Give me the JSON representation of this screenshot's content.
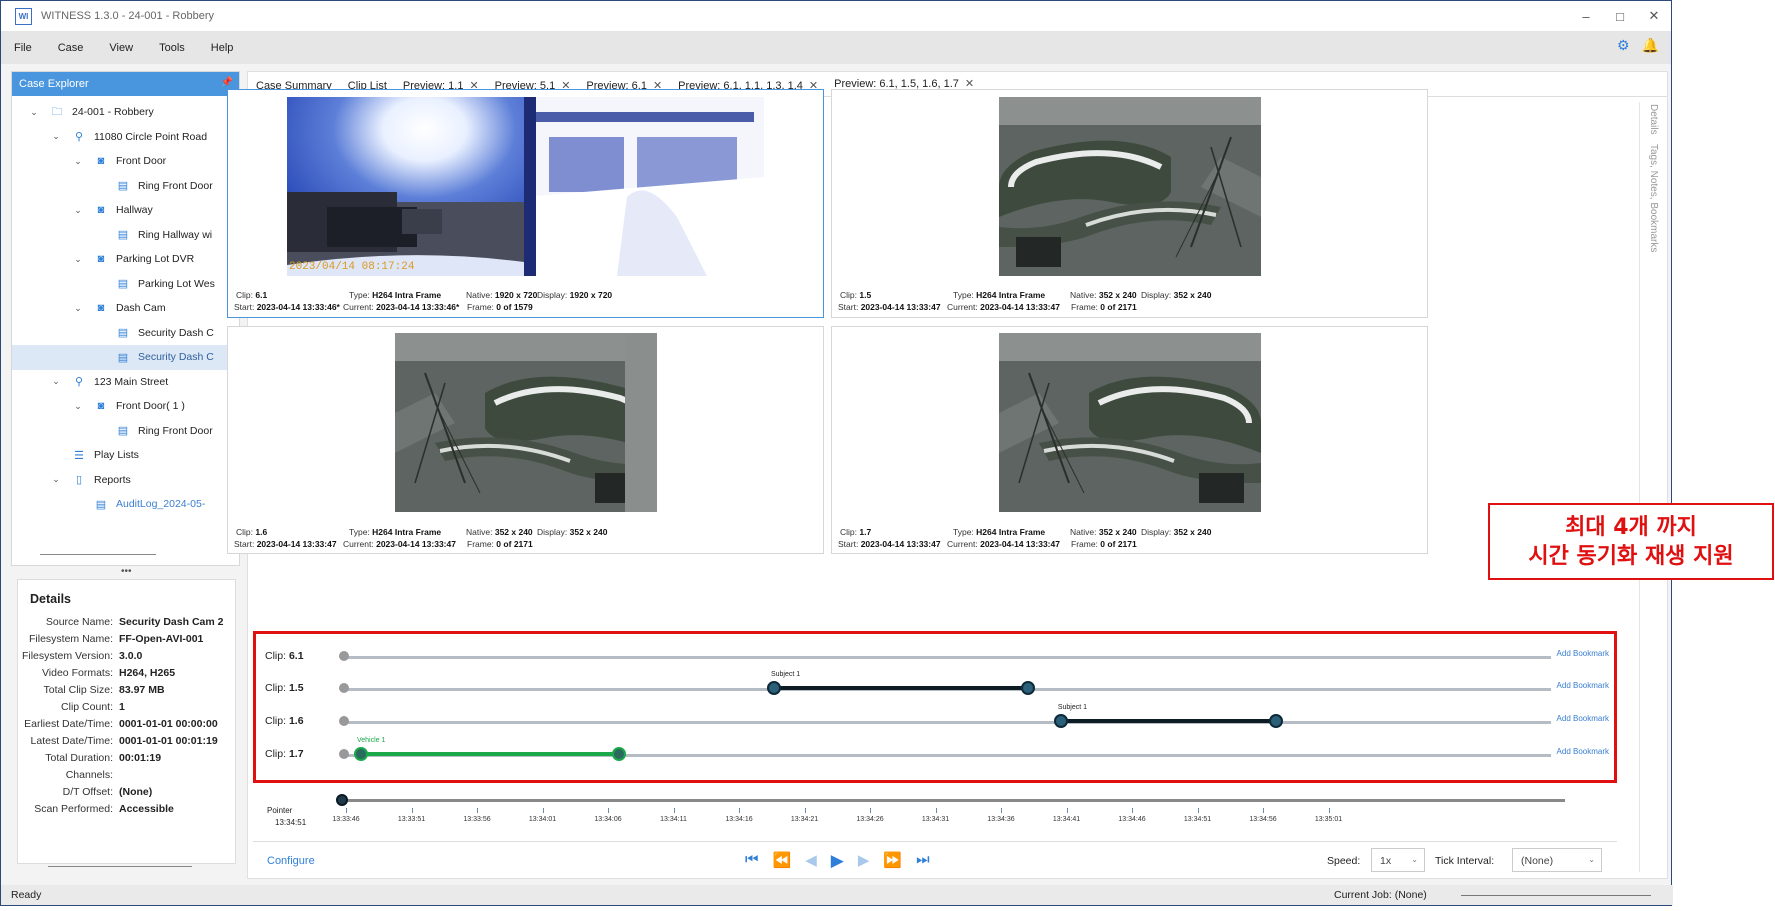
{
  "window": {
    "title": "WITNESS 1.3.0 - 24-001 - Robbery",
    "logo": "WI",
    "minimize": "–",
    "maximize": "□",
    "close": "✕"
  },
  "menu": [
    "File",
    "Case",
    "View",
    "Tools",
    "Help"
  ],
  "explorer": {
    "title": "Case Explorer",
    "tree": [
      {
        "label": "24-001 - Robbery",
        "depth": 0,
        "caret": "⌄",
        "icon": "folder-icon",
        "glyph": "🗀"
      },
      {
        "label": "11080 Circle Point Road",
        "depth": 1,
        "caret": "⌄",
        "icon": "location-pin-icon",
        "glyph": "⚲"
      },
      {
        "label": "Front Door",
        "depth": 2,
        "caret": "⌄",
        "icon": "camera-icon",
        "glyph": "◙"
      },
      {
        "label": "Ring Front Door",
        "depth": 3,
        "caret": "",
        "icon": "video-file-icon",
        "glyph": "▤"
      },
      {
        "label": "Hallway",
        "depth": 2,
        "caret": "⌄",
        "icon": "camera-icon",
        "glyph": "◙"
      },
      {
        "label": "Ring Hallway wi",
        "depth": 3,
        "caret": "",
        "icon": "video-file-icon",
        "glyph": "▤"
      },
      {
        "label": "Parking Lot DVR",
        "depth": 2,
        "caret": "⌄",
        "icon": "camera-icon",
        "glyph": "◙"
      },
      {
        "label": "Parking Lot Wes",
        "depth": 3,
        "caret": "",
        "icon": "video-file-icon",
        "glyph": "▤"
      },
      {
        "label": "Dash Cam",
        "depth": 2,
        "caret": "⌄",
        "icon": "camera-icon",
        "glyph": "◙"
      },
      {
        "label": "Security Dash C",
        "depth": 3,
        "caret": "",
        "icon": "video-file-icon",
        "glyph": "▤"
      },
      {
        "label": "Security Dash C",
        "depth": 3,
        "caret": "",
        "icon": "video-file-icon",
        "glyph": "▤",
        "selected": true
      },
      {
        "label": "123 Main Street",
        "depth": 1,
        "caret": "⌄",
        "icon": "location-pin-icon",
        "glyph": "⚲"
      },
      {
        "label": "Front Door( 1 )",
        "depth": 2,
        "caret": "⌄",
        "icon": "camera-icon",
        "glyph": "◙"
      },
      {
        "label": "Ring Front Door",
        "depth": 3,
        "caret": "",
        "icon": "video-file-icon",
        "glyph": "▤"
      },
      {
        "label": "Play Lists",
        "depth": 1,
        "caret": "",
        "icon": "list-icon",
        "glyph": "☰"
      },
      {
        "label": "Reports",
        "depth": 1,
        "caret": "⌄",
        "icon": "document-icon",
        "glyph": "▯"
      },
      {
        "label": "AuditLog_2024-05-",
        "depth": 2,
        "caret": "",
        "icon": "pdf-icon",
        "glyph": "▤",
        "link": true
      }
    ]
  },
  "details": {
    "title": "Details",
    "rows": [
      {
        "k": "Source Name:",
        "v": "Security Dash Cam 2"
      },
      {
        "k": "Filesystem Name:",
        "v": "FF-Open-AVI-001"
      },
      {
        "k": "Filesystem Version:",
        "v": "3.0.0"
      },
      {
        "k": "Video Formats:",
        "v": "H264, H265"
      },
      {
        "k": "Total Clip Size:",
        "v": "83.97 MB"
      },
      {
        "k": "Clip Count:",
        "v": "1"
      },
      {
        "k": "Earliest Date/Time:",
        "v": "0001-01-01 00:00:00"
      },
      {
        "k": "Latest Date/Time:",
        "v": "0001-01-01 00:01:19"
      },
      {
        "k": "Total Duration:",
        "v": "00:01:19"
      },
      {
        "k": "Channels:",
        "v": ""
      },
      {
        "k": "D/T Offset:",
        "v": "(None)"
      },
      {
        "k": "Scan Performed:",
        "v": "Accessible"
      }
    ]
  },
  "tabs": [
    {
      "label": "Case Summary",
      "close": false
    },
    {
      "label": "Clip List",
      "close": false
    },
    {
      "label": "Preview: 1.1",
      "close": true
    },
    {
      "label": "Preview: 5.1",
      "close": true
    },
    {
      "label": "Preview: 6.1",
      "close": true
    },
    {
      "label": "Preview: 6.1, 1.1, 1.3, 1.4",
      "close": true
    },
    {
      "label": "Preview: 6.1, 1.5, 1.6, 1.7",
      "close": true,
      "active": true
    }
  ],
  "side_tabs": [
    "Details",
    "Tags, Notes, Bookmarks"
  ],
  "panes": [
    {
      "clip": "6.1",
      "type": "H264 Intra Frame",
      "native": "1920 x 720",
      "display": "1920 x 720",
      "start": "2023-04-14 13:33:46*",
      "current": "2023-04-14 13:33:46*",
      "frame": "0",
      "of": "1579",
      "overlay": "2023/04/14 08:17:24"
    },
    {
      "clip": "1.5",
      "type": "H264 Intra Frame",
      "native": "352 x 240",
      "display": "352 x 240",
      "start": "2023-04-14 13:33:47",
      "current": "2023-04-14 13:33:47",
      "frame": "0",
      "of": "2171"
    },
    {
      "clip": "1.6",
      "type": "H264 Intra Frame",
      "native": "352 x 240",
      "display": "352 x 240",
      "start": "2023-04-14 13:33:47",
      "current": "2023-04-14 13:33:47",
      "frame": "0",
      "of": "2171"
    },
    {
      "clip": "1.7",
      "type": "H264 Intra Frame",
      "native": "352 x 240",
      "display": "352 x 240",
      "start": "2023-04-14 13:33:47",
      "current": "2023-04-14 13:33:47",
      "frame": "0",
      "of": "2171"
    }
  ],
  "meta_labels": {
    "clip": "Clip:",
    "type": "Type:",
    "native": "Native:",
    "display": "Display:",
    "start": "Start:",
    "current": "Current:",
    "frame": "Frame:",
    "of": "of"
  },
  "timeline": {
    "clip_prefix": "Clip:",
    "add_bookmark": "Add Bookmark",
    "tracks": [
      {
        "clip": "6.1",
        "tag": "",
        "color": "#000000",
        "range": null
      },
      {
        "clip": "1.5",
        "tag": "Subject 1",
        "color": "#0d1b24",
        "range": [
          0.3546,
          0.5659
        ]
      },
      {
        "clip": "1.6",
        "tag": "Subject 1",
        "color": "#0d1b24",
        "range": [
          0.5929,
          0.7718
        ]
      },
      {
        "clip": "1.7",
        "tag": "Vehicle 1",
        "color": "#1aa84a",
        "range": [
          0.0116,
          0.2261
        ]
      }
    ],
    "pointer_label": "Pointer",
    "pointer_time": "13:34:51",
    "ticks": [
      "13:33:46",
      "13:33:51",
      "13:33:56",
      "13:34:01",
      "13:34:06",
      "13:34:11",
      "13:34:16",
      "13:34:21",
      "13:34:26",
      "13:34:31",
      "13:34:36",
      "13:34:41",
      "13:34:46",
      "13:34:51",
      "13:34:56",
      "13:35:01"
    ]
  },
  "annotation": {
    "line1": "최대 4개 까지",
    "line2": "시간 동기화 재생 지원"
  },
  "controls": {
    "configure": "Configure",
    "speed_label": "Speed:",
    "speed_value": "1x",
    "tick_label": "Tick Interval:",
    "tick_value": "(None)",
    "buttons": [
      {
        "name": "skip-to-start-icon",
        "glyph": "⏮",
        "enabled": true
      },
      {
        "name": "rewind-icon",
        "glyph": "⏪",
        "enabled": true
      },
      {
        "name": "step-back-icon",
        "glyph": "◀",
        "enabled": false
      },
      {
        "name": "play-icon",
        "glyph": "▶",
        "enabled": true
      },
      {
        "name": "step-forward-icon",
        "glyph": "▶",
        "enabled": false
      },
      {
        "name": "fast-forward-icon",
        "glyph": "⏩",
        "enabled": true
      },
      {
        "name": "skip-to-end-icon",
        "glyph": "⏭",
        "enabled": true
      }
    ]
  },
  "status": {
    "left": "Ready",
    "right": "Current Job:  (None)"
  }
}
